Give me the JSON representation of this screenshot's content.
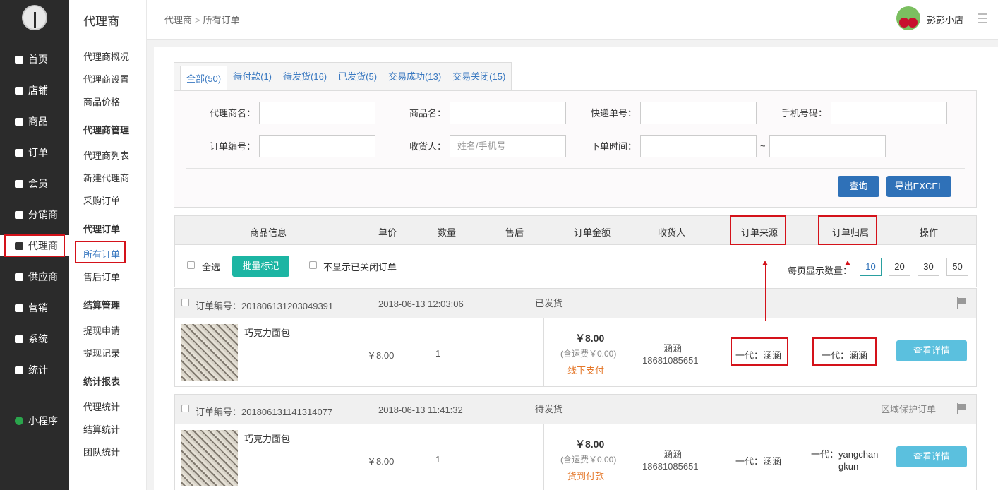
{
  "nav": {
    "items": [
      {
        "label": "首页",
        "icon": "home-icon"
      },
      {
        "label": "店铺",
        "icon": "store-icon"
      },
      {
        "label": "商品",
        "icon": "box-icon"
      },
      {
        "label": "订单",
        "icon": "cart-icon"
      },
      {
        "label": "会员",
        "icon": "user-icon"
      },
      {
        "label": "分销商",
        "icon": "sitemap-icon"
      },
      {
        "label": "代理商",
        "icon": "agent-icon"
      },
      {
        "label": "供应商",
        "icon": "warehouse-icon"
      },
      {
        "label": "营销",
        "icon": "megaphone-icon"
      },
      {
        "label": "系统",
        "icon": "gear-icon"
      },
      {
        "label": "统计",
        "icon": "bar-chart-icon"
      },
      {
        "label": "小程序",
        "icon": "mini-program-icon"
      }
    ]
  },
  "submenu": {
    "title": "代理商",
    "links_top": [
      "代理商概况",
      "代理商设置",
      "商品价格"
    ],
    "group1": "代理商管理",
    "links_g1": [
      "代理商列表",
      "新建代理商",
      "采购订单"
    ],
    "group2": "代理订单",
    "links_g2": [
      "所有订单",
      "售后订单"
    ],
    "group3": "结算管理",
    "links_g3": [
      "提现申请",
      "提现记录"
    ],
    "group4": "统计报表",
    "links_g4": [
      "代理统计",
      "结算统计",
      "团队统计"
    ]
  },
  "header": {
    "crumb_parent": "代理商",
    "crumb_sep": ">",
    "crumb_current": "所有订单",
    "shop_name": "彭彭小店"
  },
  "tabs": [
    "全部(50)",
    "待付款(1)",
    "待发货(16)",
    "已发货(5)",
    "交易成功(13)",
    "交易关闭(15)"
  ],
  "filter": {
    "agent_name": "代理商名：",
    "product_name": "商品名：",
    "express_no": "快递单号：",
    "phone": "手机号码：",
    "order_no": "订单编号：",
    "receiver": "收货人：",
    "receiver_placeholder": "姓名/手机号",
    "order_time": "下单时间：",
    "tilde": "~",
    "query_button": "查询",
    "export_button": "导出EXCEL"
  },
  "table": {
    "headers": [
      "商品信息",
      "单价",
      "数量",
      "售后",
      "订单金额",
      "收货人",
      "订单来源",
      "订单归属",
      "操作"
    ],
    "select_all": "全选",
    "batch_mark": "批量标记",
    "hide_closed": "不显示已关闭订单",
    "per_page_label": "每页显示数量：",
    "per_page_options": [
      "10",
      "20",
      "30",
      "50"
    ]
  },
  "orders": [
    {
      "order_no": "订单编号：201806131203049391",
      "time": "2018-06-13 12:03:06",
      "status": "已发货",
      "tag": "",
      "product": "巧克力面包",
      "price": "￥8.00",
      "qty": "1",
      "amount": "￥8.00",
      "shipping": "(含运费￥0.00)",
      "pay": "线下支付",
      "receiver_name": "涵涵",
      "receiver_phone": "18681085651",
      "source": "一代：涵涵",
      "owner_line1": "一代：涵涵",
      "owner_line2": "",
      "detail_button": "查看详情"
    },
    {
      "order_no": "订单编号：201806131141314077",
      "time": "2018-06-13 11:41:32",
      "status": "待发货",
      "tag": "区域保护订单",
      "product": "巧克力面包",
      "price": "￥8.00",
      "qty": "1",
      "amount": "￥8.00",
      "shipping": "(含运费￥0.00)",
      "pay": "货到付款",
      "receiver_name": "涵涵",
      "receiver_phone": "18681085651",
      "source": "一代：涵涵",
      "owner_line1": "一代：yangchan",
      "owner_line2": "gkun",
      "detail_button": "查看详情"
    }
  ]
}
